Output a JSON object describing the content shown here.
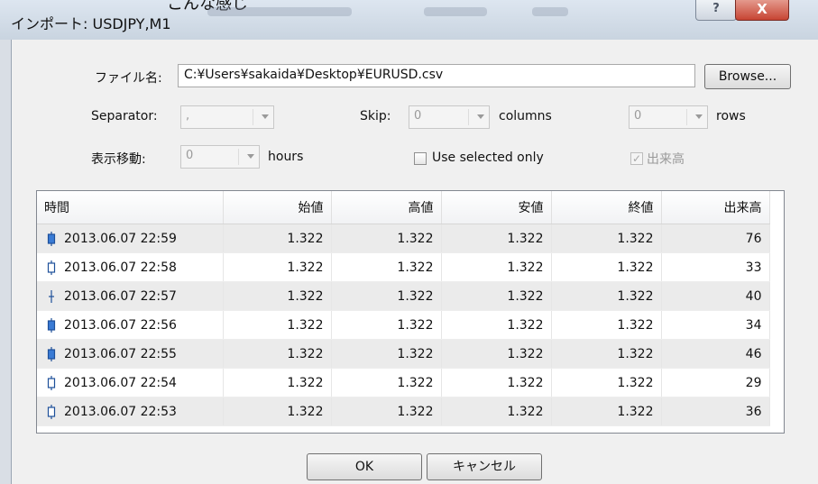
{
  "window": {
    "top_caption": "こんな感じ",
    "title": "インポート: USDJPY,M1",
    "help_label": "?",
    "close_label": "X"
  },
  "form": {
    "file_label": "ファイル名:",
    "file_path": "C:¥Users¥sakaida¥Desktop¥EURUSD.csv",
    "browse_label": "Browse...",
    "separator_label": "Separator:",
    "separator_value": ",",
    "skip_label": "Skip:",
    "skip_columns_value": "0",
    "columns_label": "columns",
    "skip_rows_value": "0",
    "rows_label": "rows",
    "shift_label": "表示移動:",
    "shift_value": "0",
    "hours_label": "hours",
    "use_selected_label": "Use selected only",
    "volume_check_label": "出来高",
    "volume_check_mark": "✓"
  },
  "table": {
    "columns": [
      "時間",
      "始値",
      "高値",
      "安値",
      "終値",
      "出来高"
    ],
    "rows": [
      {
        "time": "2013.06.07 22:59",
        "open": "1.322",
        "high": "1.322",
        "low": "1.322",
        "close": "1.322",
        "volume": "76",
        "candle": "bull-filled"
      },
      {
        "time": "2013.06.07 22:58",
        "open": "1.322",
        "high": "1.322",
        "low": "1.322",
        "close": "1.322",
        "volume": "33",
        "candle": "hollow"
      },
      {
        "time": "2013.06.07 22:57",
        "open": "1.322",
        "high": "1.322",
        "low": "1.322",
        "close": "1.322",
        "volume": "40",
        "candle": "doji"
      },
      {
        "time": "2013.06.07 22:56",
        "open": "1.322",
        "high": "1.322",
        "low": "1.322",
        "close": "1.322",
        "volume": "34",
        "candle": "bull-filled"
      },
      {
        "time": "2013.06.07 22:55",
        "open": "1.322",
        "high": "1.322",
        "low": "1.322",
        "close": "1.322",
        "volume": "46",
        "candle": "bull-filled"
      },
      {
        "time": "2013.06.07 22:54",
        "open": "1.322",
        "high": "1.322",
        "low": "1.322",
        "close": "1.322",
        "volume": "29",
        "candle": "hollow"
      },
      {
        "time": "2013.06.07 22:53",
        "open": "1.322",
        "high": "1.322",
        "low": "1.322",
        "close": "1.322",
        "volume": "36",
        "candle": "hollow"
      }
    ]
  },
  "buttons": {
    "ok_label": "OK",
    "cancel_label": "キャンセル"
  },
  "colors": {
    "candle_fill": "#3a7bd5",
    "candle_stroke": "#1d4f9a"
  }
}
